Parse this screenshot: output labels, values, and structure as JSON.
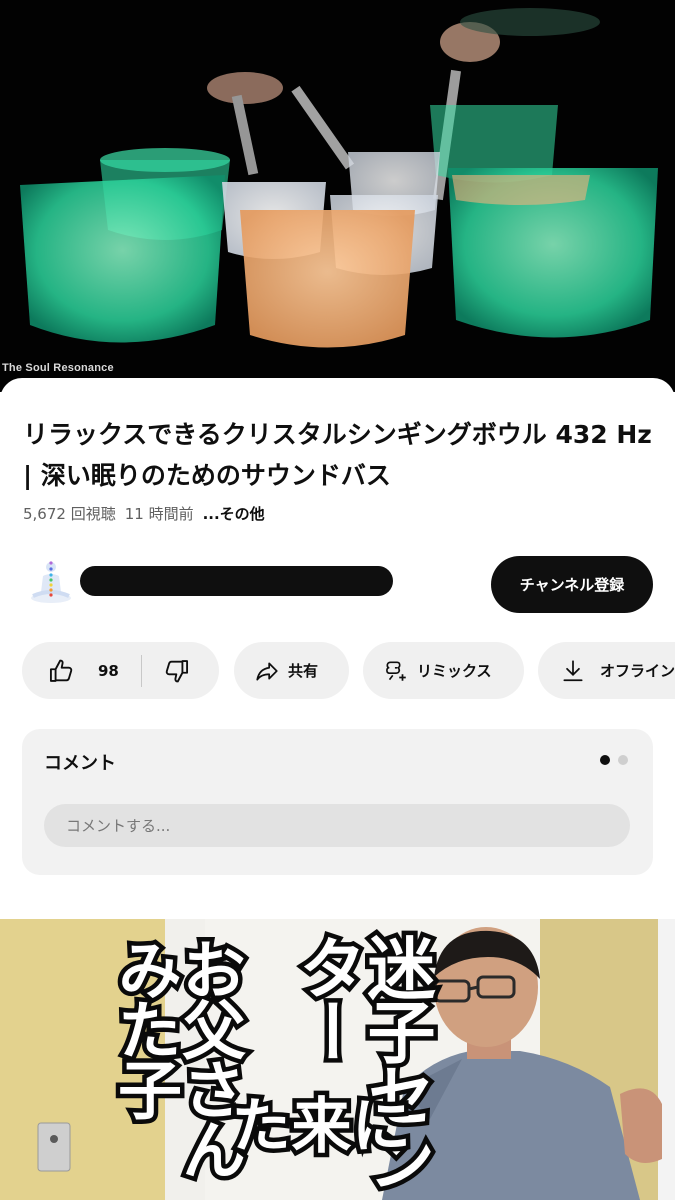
{
  "player": {
    "watermark": "The Soul Resonance"
  },
  "video": {
    "title": "リラックスできるクリスタルシンギングボウル 432 Hz | 深い眠りのためのサウンドバス",
    "views": "5,672 回視聴",
    "age": "11 時間前",
    "more": "...その他"
  },
  "channel": {
    "subscribe_label": "チャンネル登録"
  },
  "actions": {
    "like_count": "98",
    "share_label": "共有",
    "remix_label": "リミックス",
    "offline_label": "オフライン"
  },
  "comments": {
    "title": "コメント",
    "placeholder": "コメントする..."
  },
  "next_video": {
    "caption_left": "お父さんみた子",
    "caption_mid": "迷子センター",
    "caption_right": "に来た"
  },
  "icons": [
    "thumbs-up-icon",
    "thumbs-down-icon",
    "share-icon",
    "remix-icon",
    "download-icon",
    "meditation-avatar-icon"
  ],
  "colors": {
    "subscribe_bg": "#0f0f0f",
    "chip_bg": "#f0f0f0",
    "comment_card_bg": "#f2f2f2"
  }
}
